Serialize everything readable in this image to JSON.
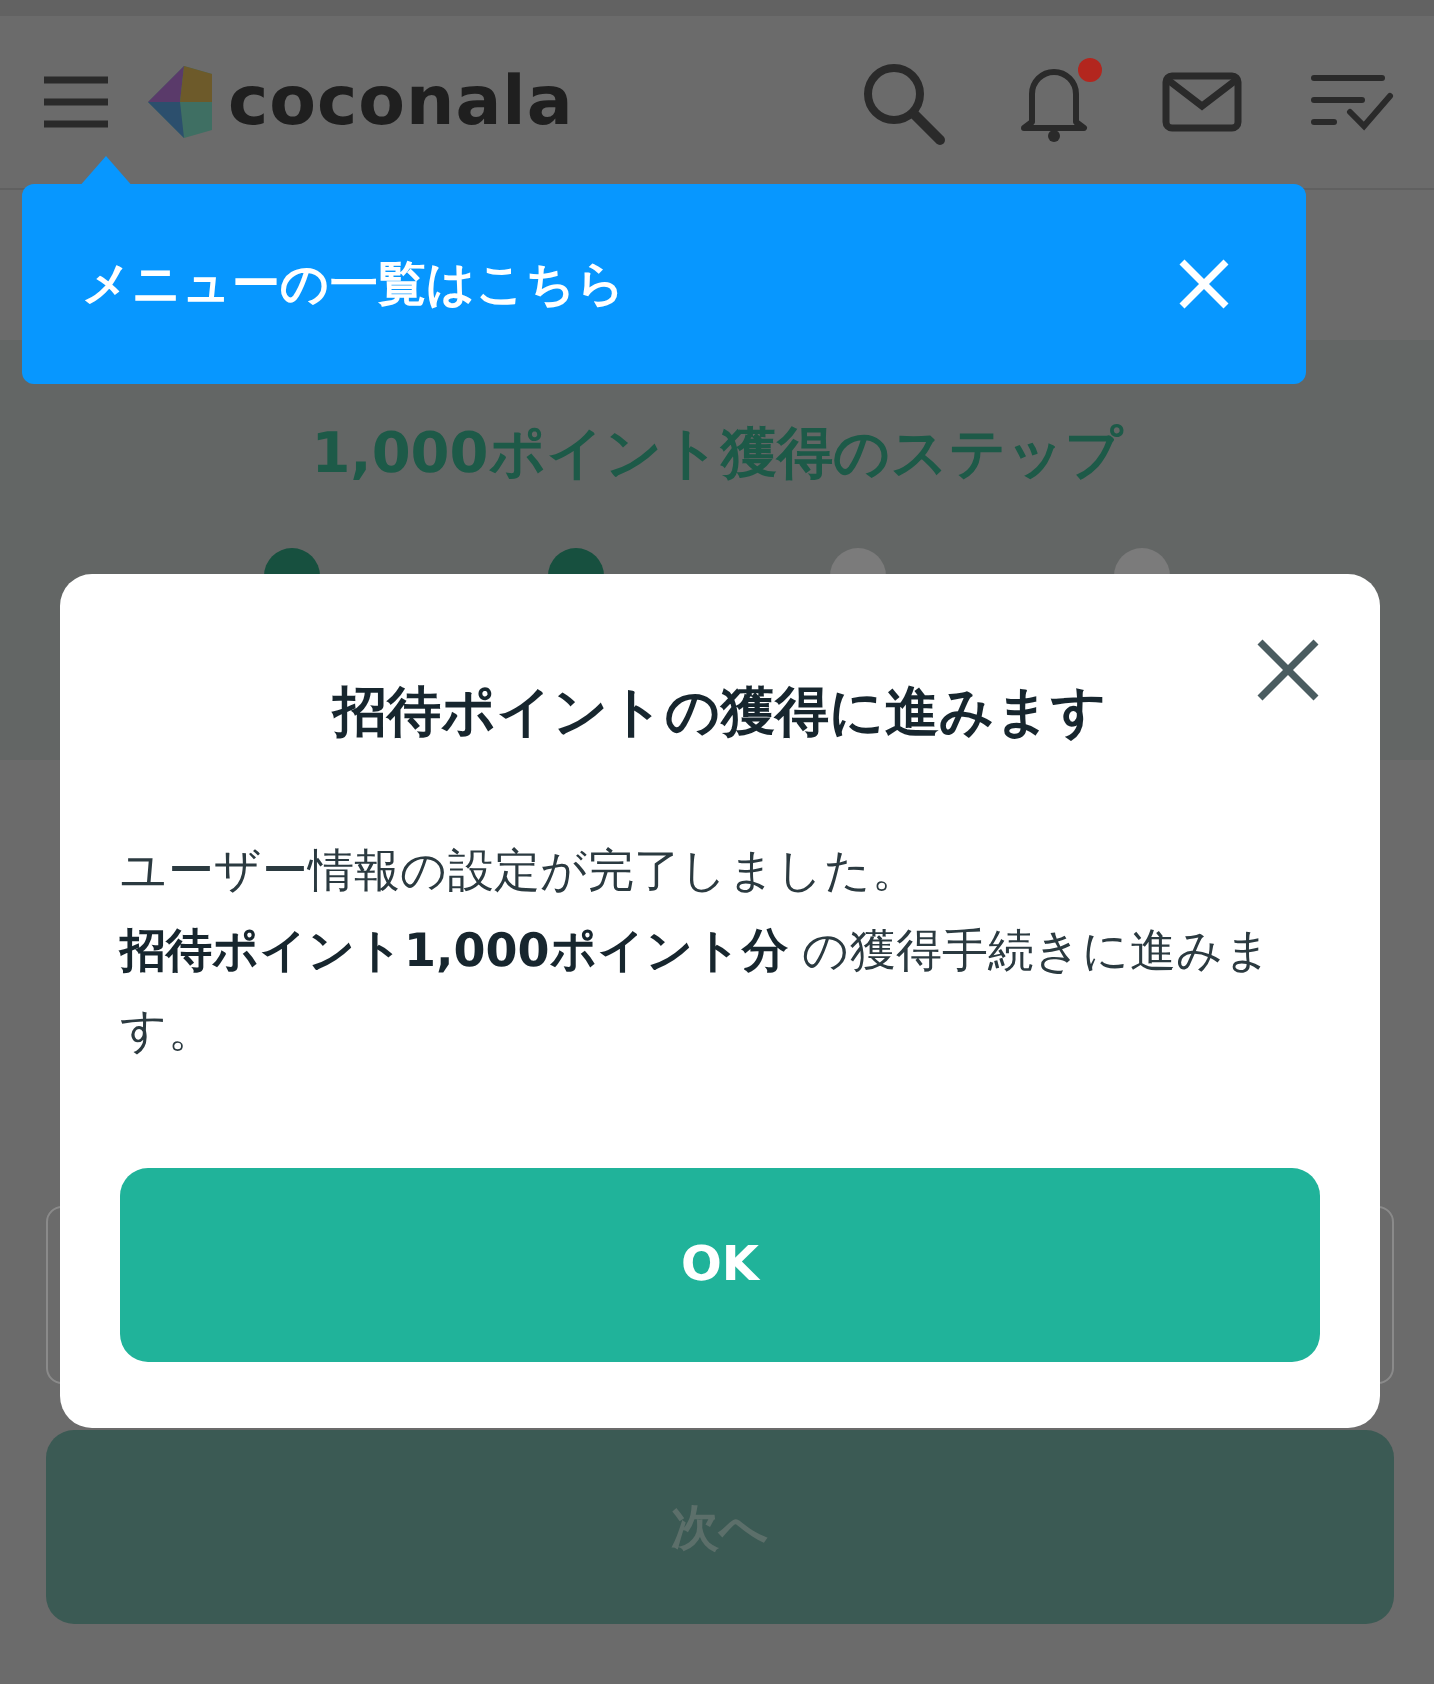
{
  "header": {
    "logo": "coconala",
    "notification_badge": true
  },
  "tooltip": {
    "text": "メニューの一覧はこちら"
  },
  "steps": {
    "title": "1,000ポイント獲得のステップ",
    "items": [
      {
        "done": true
      },
      {
        "done": true
      },
      {
        "done": false
      },
      {
        "done": false
      }
    ]
  },
  "next_button": {
    "label": "次へ",
    "disabled": true
  },
  "modal": {
    "title": "招待ポイントの獲得に進みます",
    "lines": [
      "ユーザー情報の設定が完了しました。",
      "**招待ポイント1,000ポイント分** の獲得手続きに進みます。"
    ],
    "button": "OK"
  }
}
